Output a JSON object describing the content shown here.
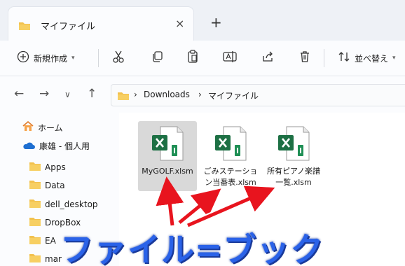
{
  "tab": {
    "title": "マイファイル",
    "close": "×",
    "new_tab": "+"
  },
  "toolbar": {
    "new_label": "新規作成",
    "sort_label": "並べ替え"
  },
  "address": {
    "crumbs": [
      "Downloads",
      "マイファイル"
    ],
    "sep": "›"
  },
  "sidebar": {
    "items": [
      {
        "label": "ホーム",
        "icon": "home-icon"
      },
      {
        "label": "康雄 - 個人用",
        "icon": "cloud-icon"
      },
      {
        "label": "Apps",
        "icon": "folder-icon"
      },
      {
        "label": "Data",
        "icon": "folder-icon"
      },
      {
        "label": "dell_desktop",
        "icon": "folder-icon"
      },
      {
        "label": "DropBox",
        "icon": "folder-icon"
      },
      {
        "label": "EA",
        "icon": "folder-icon"
      },
      {
        "label": "mar",
        "icon": "folder-icon"
      }
    ]
  },
  "files": [
    {
      "name": "MyGOLF.xlsm",
      "selected": true
    },
    {
      "name": "ごみステーション当番表.xlsm",
      "selected": false
    },
    {
      "name": "所有ピアノ楽譜一覧.xlsm",
      "selected": false
    }
  ],
  "overlay": {
    "caption": "ファイル=ブック"
  },
  "colors": {
    "folder": "#f2c14e",
    "excel": "#1d7044",
    "arrow": "#e8141e",
    "caption": "#2a62e8"
  }
}
